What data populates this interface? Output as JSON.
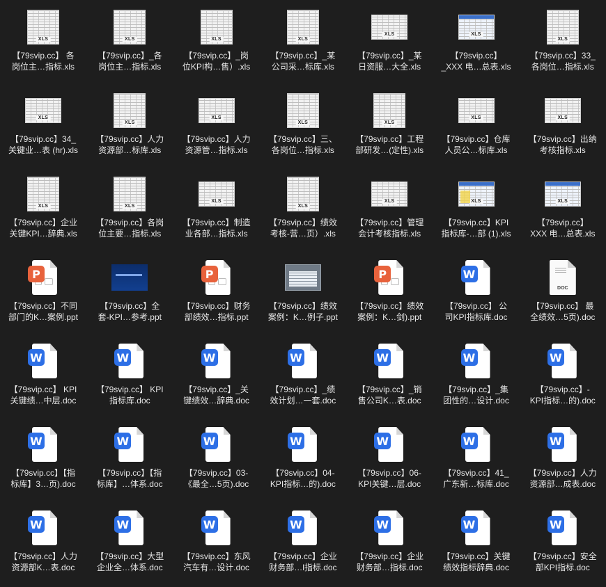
{
  "items": [
    {
      "icon": "xls",
      "line1": "【79svip.cc】 各",
      "line2": "岗位主…指标.xls"
    },
    {
      "icon": "xls",
      "line1": "【79svip.cc】_各",
      "line2": "岗位主…指标.xls"
    },
    {
      "icon": "xls",
      "line1": "【79svip.cc】_岗",
      "line2": "位KPI构…售）.xls"
    },
    {
      "icon": "xls",
      "line1": "【79svip.cc】_某",
      "line2": "公司采…标库.xls"
    },
    {
      "icon": "xls-wide",
      "line1": "【79svip.cc】_某",
      "line2": "日资服…大全.xls"
    },
    {
      "icon": "xls-color",
      "line1": "【79svip.cc】",
      "line2": "_XXX 电…总表.xls"
    },
    {
      "icon": "xls",
      "line1": "【79svip.cc】33_",
      "line2": "各岗位…指标.xls"
    },
    {
      "icon": "xls-wide",
      "line1": "【79svip.cc】34_",
      "line2": "关键业…表 (hr).xls"
    },
    {
      "icon": "xls",
      "line1": "【79svip.cc】人力",
      "line2": "资源部…标库.xls"
    },
    {
      "icon": "xls-wide",
      "line1": "【79svip.cc】人力",
      "line2": "资源管…指标.xls"
    },
    {
      "icon": "xls",
      "line1": "【79svip.cc】三、",
      "line2": "各岗位…指标.xls"
    },
    {
      "icon": "xls",
      "line1": "【79svip.cc】工程",
      "line2": "部研发…(定性).xls"
    },
    {
      "icon": "xls-wide",
      "line1": "【79svip.cc】仓库",
      "line2": "人员公…标库.xls"
    },
    {
      "icon": "xls-wide",
      "line1": "【79svip.cc】出纳",
      "line2": "考核指标.xls"
    },
    {
      "icon": "xls",
      "line1": "【79svip.cc】企业",
      "line2": "关键KPI…辞典.xls"
    },
    {
      "icon": "xls",
      "line1": "【79svip.cc】各岗",
      "line2": "位主要…指标.xls"
    },
    {
      "icon": "xls-wide",
      "line1": "【79svip.cc】制造",
      "line2": "业各部…指标.xls"
    },
    {
      "icon": "xls",
      "line1": "【79svip.cc】绩效",
      "line2": "考核-营…页）.xls"
    },
    {
      "icon": "xls-wide",
      "line1": "【79svip.cc】管理",
      "line2": "会计考核指标.xls"
    },
    {
      "icon": "xls-yellow",
      "line1": "【79svip.cc】KPI",
      "line2": "指标库-…部 (1).xls"
    },
    {
      "icon": "xls-color",
      "line1": "【79svip.cc】",
      "line2": "XXX 电…总表.xls"
    },
    {
      "icon": "ppt",
      "line1": "【79svip.cc】不同",
      "line2": "部门的K…案例.ppt"
    },
    {
      "icon": "slide-blue",
      "line1": "【79svip.cc】全",
      "line2": "套-KPI…参考.ppt"
    },
    {
      "icon": "ppt",
      "line1": "【79svip.cc】财务",
      "line2": "部绩效…指标.ppt"
    },
    {
      "icon": "slide-gray",
      "line1": "【79svip.cc】绩效",
      "line2": "案例：K…例子.ppt"
    },
    {
      "icon": "ppt",
      "line1": "【79svip.cc】绩效",
      "line2": "案例：K…剑).ppt"
    },
    {
      "icon": "word",
      "line1": "【79svip.cc】 公",
      "line2": "司KPI指标库.doc"
    },
    {
      "icon": "doc-plain",
      "line1": "【79svip.cc】 最",
      "line2": "全绩效…5页).doc"
    },
    {
      "icon": "word",
      "line1": "【79svip.cc】 KPI",
      "line2": "关键绩…中层.doc"
    },
    {
      "icon": "word",
      "line1": "【79svip.cc】 KPI",
      "line2": "指标库.doc"
    },
    {
      "icon": "word",
      "line1": "【79svip.cc】_关",
      "line2": "键绩效…辞典.doc"
    },
    {
      "icon": "word",
      "line1": "【79svip.cc】_绩",
      "line2": "效计划…一套.doc"
    },
    {
      "icon": "word",
      "line1": "【79svip.cc】_销",
      "line2": "售公司K…表.doc"
    },
    {
      "icon": "word",
      "line1": "【79svip.cc】_集",
      "line2": "团性的…设计.doc"
    },
    {
      "icon": "word",
      "line1": "【79svip.cc】-",
      "line2": "KPI指标…的).doc"
    },
    {
      "icon": "word",
      "line1": "【79svip.cc】【指",
      "line2": "标库】3…页).doc"
    },
    {
      "icon": "word",
      "line1": "【79svip.cc】【指",
      "line2": "标库】…体系.doc"
    },
    {
      "icon": "word",
      "line1": "【79svip.cc】03-",
      "line2": "《最全…5页).doc"
    },
    {
      "icon": "word",
      "line1": "【79svip.cc】04-",
      "line2": "KPI指标…的).doc"
    },
    {
      "icon": "word",
      "line1": "【79svip.cc】06-",
      "line2": "KPI关键…层.doc"
    },
    {
      "icon": "word",
      "line1": "【79svip.cc】41_",
      "line2": "广东新…标库.doc"
    },
    {
      "icon": "word",
      "line1": "【79svip.cc】人力",
      "line2": "资源部…成表.doc"
    },
    {
      "icon": "word",
      "line1": "【79svip.cc】人力",
      "line2": "资源部K…表.doc"
    },
    {
      "icon": "word",
      "line1": "【79svip.cc】大型",
      "line2": "企业全…体系.doc"
    },
    {
      "icon": "word",
      "line1": "【79svip.cc】东风",
      "line2": "汽车有…设计.doc"
    },
    {
      "icon": "word",
      "line1": "【79svip.cc】企业",
      "line2": "财务部…l指标.doc"
    },
    {
      "icon": "word",
      "line1": "【79svip.cc】企业",
      "line2": "财务部…指标.doc"
    },
    {
      "icon": "word",
      "line1": "【79svip.cc】关键",
      "line2": "绩效指标辞典.doc"
    },
    {
      "icon": "word",
      "line1": "【79svip.cc】安全",
      "line2": "部KPI指标.doc"
    }
  ],
  "tags": {
    "xls": "XLS",
    "doc": "DOC",
    "word": "W",
    "ppt": "P"
  }
}
